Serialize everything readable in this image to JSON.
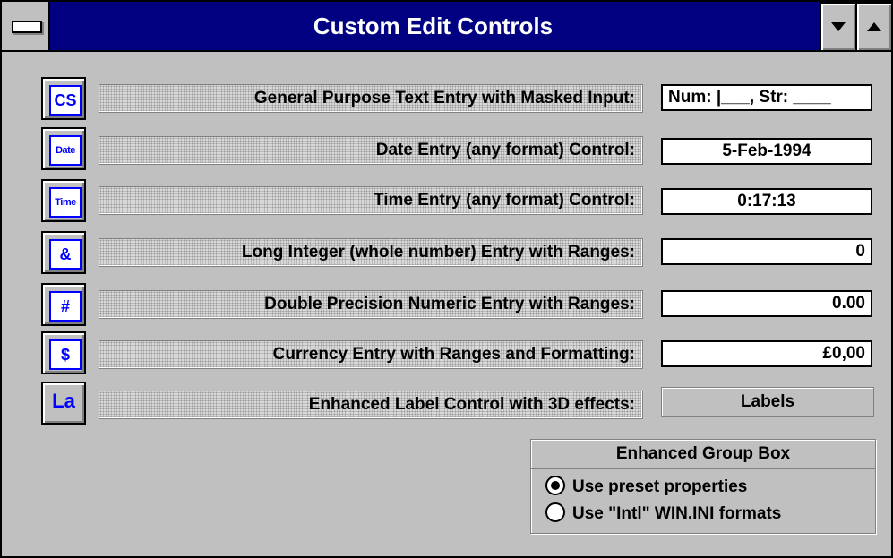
{
  "window": {
    "title": "Custom Edit Controls"
  },
  "rows": [
    {
      "icon_text": "CS",
      "icon_name": "cs-text-icon",
      "label": "General Purpose Text Entry with Masked Input:",
      "value": "Num: |___, Str: ____"
    },
    {
      "icon_text": "Date",
      "icon_name": "date-icon",
      "label": "Date Entry (any format) Control:",
      "value": "5-Feb-1994"
    },
    {
      "icon_text": "Time",
      "icon_name": "time-icon",
      "label": "Time Entry (any format) Control:",
      "value": "0:17:13"
    },
    {
      "icon_text": "&",
      "icon_name": "long-integer-icon",
      "label": "Long Integer (whole number) Entry with Ranges:",
      "value": "0"
    },
    {
      "icon_text": "#",
      "icon_name": "double-precision-icon",
      "label": "Double Precision Numeric Entry with Ranges:",
      "value": "0.00"
    },
    {
      "icon_text": "$",
      "icon_name": "currency-icon",
      "label": "Currency Entry with Ranges and Formatting:",
      "value": "£0,00"
    },
    {
      "icon_text": "La",
      "icon_name": "label-icon",
      "label": "Enhanced Label Control with 3D effects:",
      "value": "Labels"
    }
  ],
  "group": {
    "title": "Enhanced Group Box",
    "options": [
      {
        "label": "Use preset properties",
        "selected": true
      },
      {
        "label": "Use \"Intl\" WIN.INI formats",
        "selected": false
      }
    ]
  },
  "colors": {
    "title_bar": "#000080",
    "icon_accent": "#0000ff",
    "face": "#c0c0c0"
  }
}
